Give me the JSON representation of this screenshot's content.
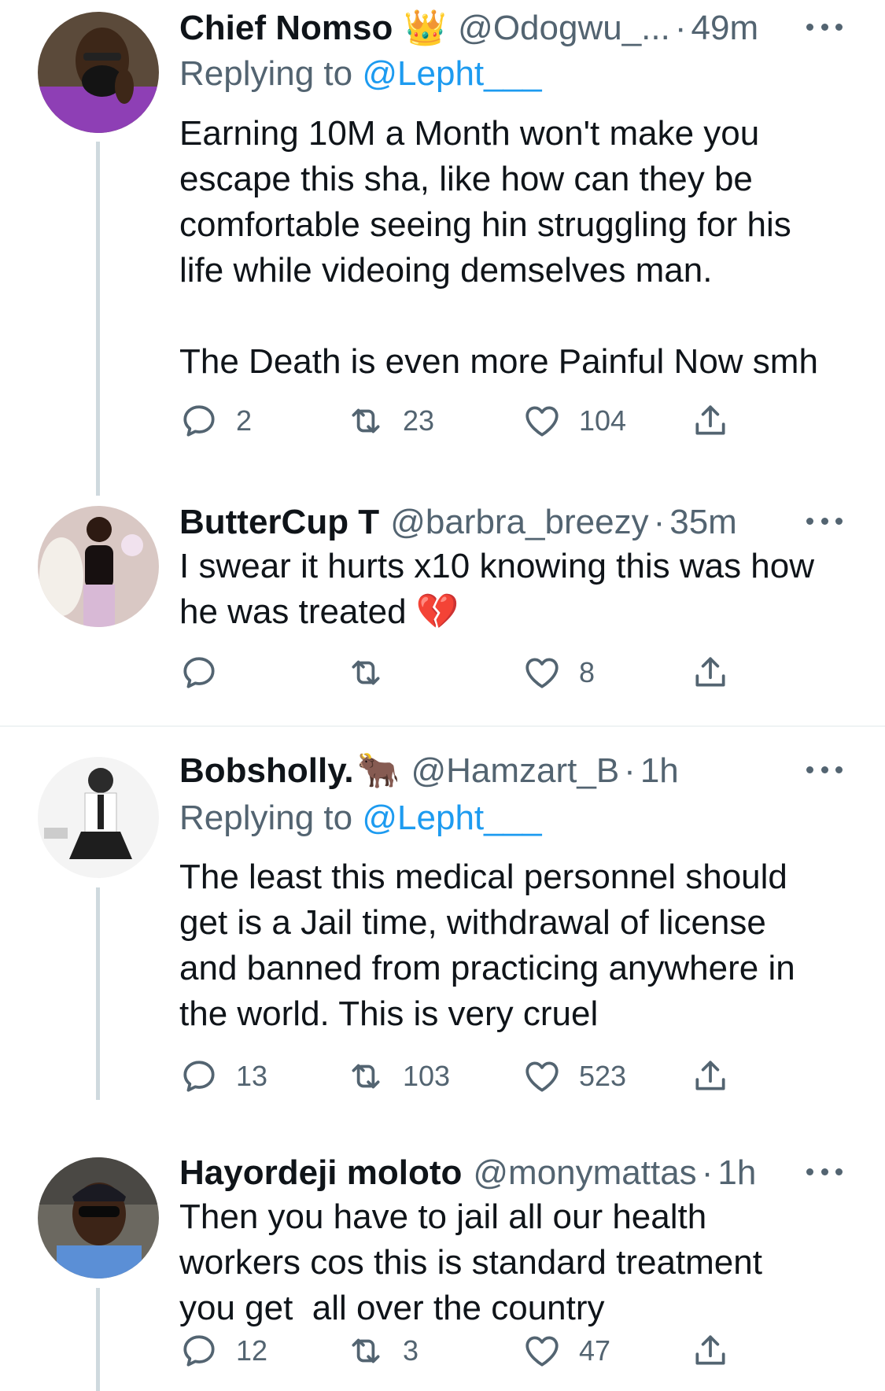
{
  "tweets": [
    {
      "name": "Chief Nomso",
      "name_emoji": "👑",
      "handle": "@Odogwu_...",
      "separator": "·",
      "time": "49m",
      "replying_label": "Replying to",
      "replying_to": "@Lepht___",
      "text": "Earning 10M a Month won't make you\nescape this sha, like how can they be\ncomfortable seeing hin struggling for his\nlife while videoing demselves man.\n\nThe Death is even more Painful Now smh",
      "replies": "2",
      "retweets": "23",
      "likes": "104"
    },
    {
      "name": "ButterCup T",
      "handle": "@barbra_breezy",
      "separator": "·",
      "time": "35m",
      "text": "I swear it hurts x10 knowing this was how\nhe was treated 💔",
      "replies": "",
      "retweets": "",
      "likes": "8"
    },
    {
      "name": "Bobsholly.",
      "name_emoji": "🐂",
      "handle": "@Hamzart_B",
      "separator": "·",
      "time": "1h",
      "replying_label": "Replying to",
      "replying_to": "@Lepht___",
      "text": "The least this medical personnel should\nget is a Jail time, withdrawal of license\nand banned from practicing anywhere in\nthe world. This is very cruel",
      "replies": "13",
      "retweets": "103",
      "likes": "523"
    },
    {
      "name": "Hayordeji moloto",
      "handle": "@monymattas",
      "separator": "·",
      "time": "1h",
      "text": "Then you have to jail all our health\nworkers cos this is standard treatment\nyou get  all over the country",
      "replies": "12",
      "retweets": "3",
      "likes": "47"
    }
  ],
  "icons": {
    "reply": "reply-icon",
    "retweet": "retweet-icon",
    "like": "like-icon",
    "share": "share-icon",
    "more": "more-icon"
  },
  "colors": {
    "text": "#0f1419",
    "secondary": "#536471",
    "link": "#1d9bf0",
    "thread_line": "#cfd9de",
    "divider": "#eff3f4"
  }
}
